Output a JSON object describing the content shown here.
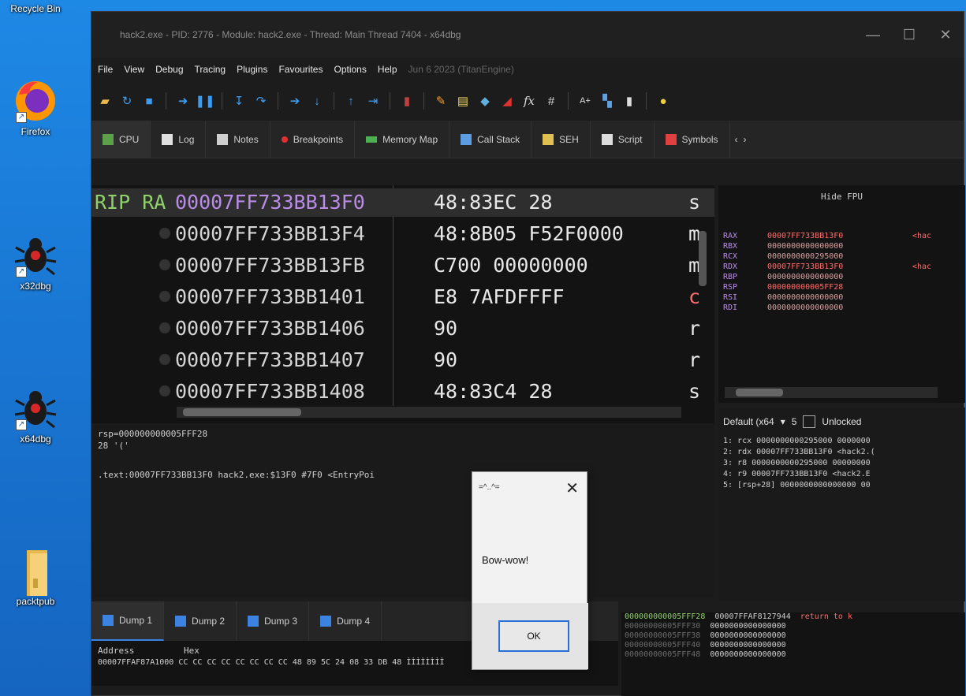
{
  "desktop": {
    "recycle_bin": "Recycle Bin",
    "icons": [
      "Firefox",
      "x32dbg",
      "x64dbg",
      "packtpub"
    ]
  },
  "window": {
    "title": "hack2.exe - PID: 2776 - Module: hack2.exe - Thread: Main Thread 7404 - x64dbg",
    "minimize": "—",
    "maximize": "☐",
    "close": "✕"
  },
  "menu": {
    "items": [
      "File",
      "View",
      "Debug",
      "Tracing",
      "Plugins",
      "Favourites",
      "Options",
      "Help"
    ],
    "version": "Jun 6 2023 (TitanEngine)"
  },
  "toolbar_icons": [
    "open-icon",
    "restart-icon",
    "stop-icon",
    "run-icon",
    "pause-icon",
    "step-into-icon",
    "step-over-icon",
    "run-to-icon",
    "animate-icon",
    "execute-till-return-icon",
    "run-to-user-code-icon",
    "trace-icon",
    "pen-icon",
    "comment-icon",
    "label-icon",
    "bookmark-icon",
    "function-icon",
    "hash-icon",
    "font-icon",
    "module-icon",
    "thread-icon",
    "lightbulb-icon"
  ],
  "tabs": [
    "CPU",
    "Log",
    "Notes",
    "Breakpoints",
    "Memory Map",
    "Call Stack",
    "SEH",
    "Script",
    "Symbols"
  ],
  "disasm": {
    "rows": [
      {
        "label": "RIP RA",
        "addr": "00007FF733BB13F0",
        "bytes": "48:83EC 28",
        "instr": "s"
      },
      {
        "label": "",
        "addr": "00007FF733BB13F4",
        "bytes": "48:8B05 F52F0000",
        "instr": "m"
      },
      {
        "label": "",
        "addr": "00007FF733BB13FB",
        "bytes": "C700 00000000",
        "instr": "m"
      },
      {
        "label": "",
        "addr": "00007FF733BB1401",
        "bytes": "E8 7AFDFFFF",
        "instr": "c"
      },
      {
        "label": "",
        "addr": "00007FF733BB1406",
        "bytes": "90",
        "instr": "r"
      },
      {
        "label": "",
        "addr": "00007FF733BB1407",
        "bytes": "90",
        "instr": "r"
      },
      {
        "label": "",
        "addr": "00007FF733BB1408",
        "bytes": "48:83C4 28",
        "instr": "s"
      }
    ]
  },
  "info": {
    "lines": [
      "rsp=000000000005FFF28",
      "28 '('",
      "",
      ".text:00007FF733BB13F0 hack2.exe:$13F0 #7F0 <EntryPoi"
    ]
  },
  "registers": {
    "hide_fpu": "Hide FPU",
    "rows": [
      {
        "name": "RAX",
        "value": "00007FF733BB13F0",
        "comment": "<hac",
        "changed": true
      },
      {
        "name": "RBX",
        "value": "0000000000000000",
        "comment": "",
        "changed": false
      },
      {
        "name": "RCX",
        "value": "0000000000295000",
        "comment": "",
        "changed": false
      },
      {
        "name": "RDX",
        "value": "00007FF733BB13F0",
        "comment": "<hac",
        "changed": true
      },
      {
        "name": "RBP",
        "value": "0000000000000000",
        "comment": "",
        "changed": false
      },
      {
        "name": "RSP",
        "value": "000000000005FF28",
        "comment": "",
        "changed": true
      },
      {
        "name": "RSI",
        "value": "0000000000000000",
        "comment": "",
        "changed": false
      },
      {
        "name": "RDI",
        "value": "0000000000000000",
        "comment": "",
        "changed": false
      }
    ]
  },
  "args": {
    "convention": "Default (x64",
    "count": "5",
    "unlocked": "Unlocked",
    "lines": [
      "1: rcx 0000000000295000 0000000",
      "2: rdx 00007FF733BB13F0 <hack2.(",
      "3: r8 0000000000295000 00000000",
      "4: r9 00007FF733BB13F0 <hack2.E",
      "5: [rsp+28] 0000000000000000 00"
    ]
  },
  "dump_tabs": [
    "Dump 1",
    "Dump 2",
    "Dump 3",
    "Dump 4"
  ],
  "dump": {
    "col_address": "Address",
    "col_hex": "Hex",
    "row": "00007FFAF87A1000 CC CC CC CC CC CC CC CC 48 89 5C 24 08 33 DB 48 ÌÌÌÌÌÌÌÌ"
  },
  "stack": {
    "rows": [
      {
        "addr": "000000000005FFF28",
        "value": "00007FFAF8127944",
        "comment": "return to k",
        "hl": true
      },
      {
        "addr": "00000000005FFF30",
        "value": "0000000000000000",
        "comment": "",
        "hl": false
      },
      {
        "addr": "00000000005FFF38",
        "value": "0000000000000000",
        "comment": "",
        "hl": false
      },
      {
        "addr": "00000000005FFF40",
        "value": "0000000000000000",
        "comment": "",
        "hl": false
      },
      {
        "addr": "00000000005FFF48",
        "value": "0000000000000000",
        "comment": "",
        "hl": false
      }
    ]
  },
  "msgbox": {
    "title": "=^..^=",
    "body": "Bow-wow!",
    "ok": "OK"
  }
}
